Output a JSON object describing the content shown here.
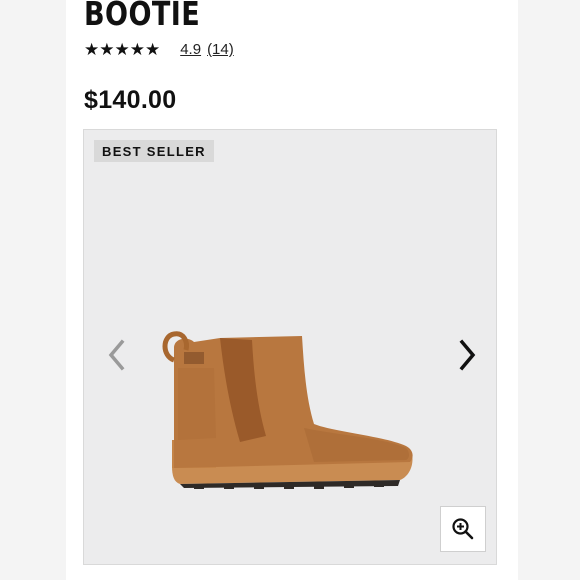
{
  "product": {
    "title": "BOOTIE",
    "stars": "★★★★★",
    "rating_value": "4.9",
    "rating_count": "(14)",
    "price": "$140.00"
  },
  "gallery": {
    "badge": "BEST SELLER",
    "prev_icon": "chevron-left-icon",
    "next_icon": "chevron-right-icon",
    "zoom_icon": "zoom-in-icon",
    "image_alt": "brown suede chelsea wedge bootie"
  },
  "colors": {
    "page_bg": "#f4f4f4",
    "gallery_bg": "#ececed",
    "badge_bg": "#d9d9d9",
    "boot_tan": "#b8773f",
    "sole": "#c98c52"
  }
}
